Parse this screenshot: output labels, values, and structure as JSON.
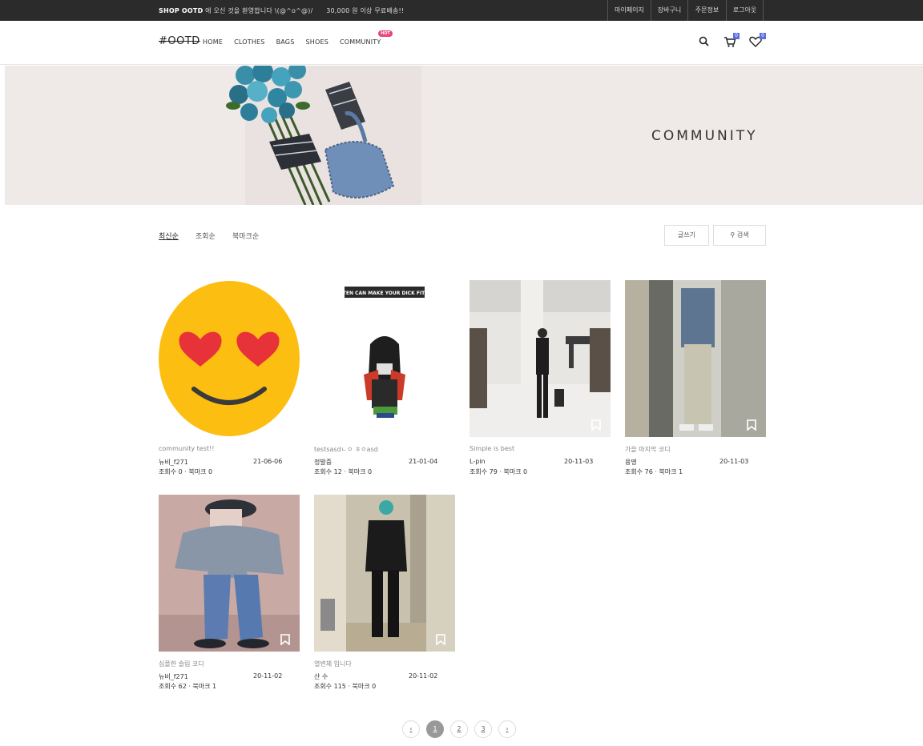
{
  "topbar": {
    "promo_brand": "SHOP OOTD",
    "promo_text": "에 오신 것을 환영합니다 \\(@^o^@)/",
    "shipping_text": "30,000 원 이상 무료배송!!",
    "links": [
      {
        "label": "마이페이지"
      },
      {
        "label": "장바구니"
      },
      {
        "label": "주문정보"
      },
      {
        "label": "로그아웃"
      }
    ]
  },
  "nav": {
    "logo": "#OOTD",
    "menu": [
      {
        "label": "HOME"
      },
      {
        "label": "CLOTHES"
      },
      {
        "label": "BAGS"
      },
      {
        "label": "SHOES"
      },
      {
        "label": "COMMUNITY"
      }
    ],
    "hot_badge": "HOT",
    "cart_count": "0",
    "wish_count": "0"
  },
  "banner": {
    "title": "COMMUNITY"
  },
  "sort_options": [
    {
      "label": "최신순",
      "active": true
    },
    {
      "label": "조회순",
      "active": false
    },
    {
      "label": "북마크순",
      "active": false
    }
  ],
  "actions": {
    "write_label": "글쓰기",
    "search_label": "검색"
  },
  "posts": [
    {
      "title": "community test!!",
      "author": "뉴비_f271",
      "date": "21-06-06",
      "stats": "조회수 0 · 북마크 0",
      "image": "smiley-hearts"
    },
    {
      "title": "testsasdㄴㅇ ㅎㅇasd",
      "author": "정발중",
      "date": "21-01-04",
      "stats": "조회수 12 · 북마크 0",
      "image": "cartoon-figure",
      "caption": "GLUTEN CAN MAKE YOUR DICK FIT OFF"
    },
    {
      "title": "Simple is best",
      "author": "L-pin",
      "date": "20-11-03",
      "stats": "조회수 79 · 북마크 0",
      "image": "store-mirror-photo"
    },
    {
      "title": "가을 마지막 코디",
      "author": "용명",
      "date": "20-11-03",
      "stats": "조회수 76 · 북마크 1",
      "image": "mirror-jacket-photo"
    },
    {
      "title": "심플한 슬림 코디",
      "author": "뉴비_f271",
      "date": "20-11-02",
      "stats": "조회수 62 · 북마크 1",
      "image": "blurred-denim-photo"
    },
    {
      "title": "열변체 입니다",
      "author": "산 수",
      "date": "20-11-02",
      "stats": "조회수 115 · 북마크 0",
      "image": "fitting-room-photo"
    }
  ],
  "pagination": {
    "prev": "‹",
    "next": "›",
    "pages": [
      "1",
      "2",
      "3"
    ],
    "current": "1"
  },
  "colors": {
    "topbar": "#2b2b2b",
    "banner_bg": "#efe9e8",
    "badge": "#5a6ee0",
    "hot": "#e8437a"
  },
  "icons": [
    "search-icon",
    "cart-icon",
    "heart-icon",
    "bookmark-icon"
  ]
}
